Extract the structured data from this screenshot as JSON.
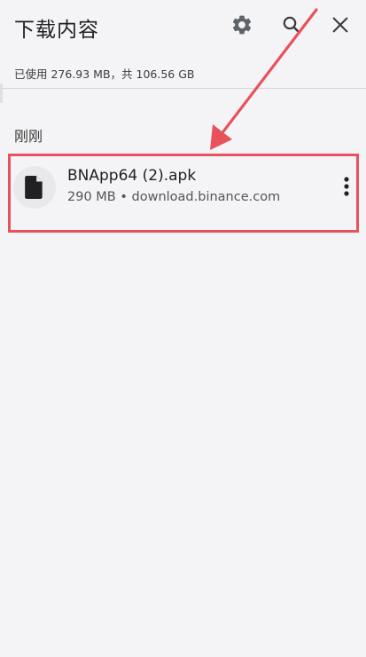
{
  "header": {
    "title": "下载内容",
    "settings_icon": "gear-icon",
    "search_icon": "search-icon",
    "close_icon": "close-icon"
  },
  "storage": {
    "text": "已使用 276.93 MB，共 106.56 GB"
  },
  "section": {
    "label": "刚刚"
  },
  "downloads": [
    {
      "name": "BNApp64 (2).apk",
      "meta": "290 MB • download.binance.com",
      "icon": "file-icon",
      "menu_icon": "more-vert-icon"
    }
  ],
  "colors": {
    "background": "#f4f4f6",
    "highlight": "#e8525b",
    "arrow": "#e8525b"
  }
}
